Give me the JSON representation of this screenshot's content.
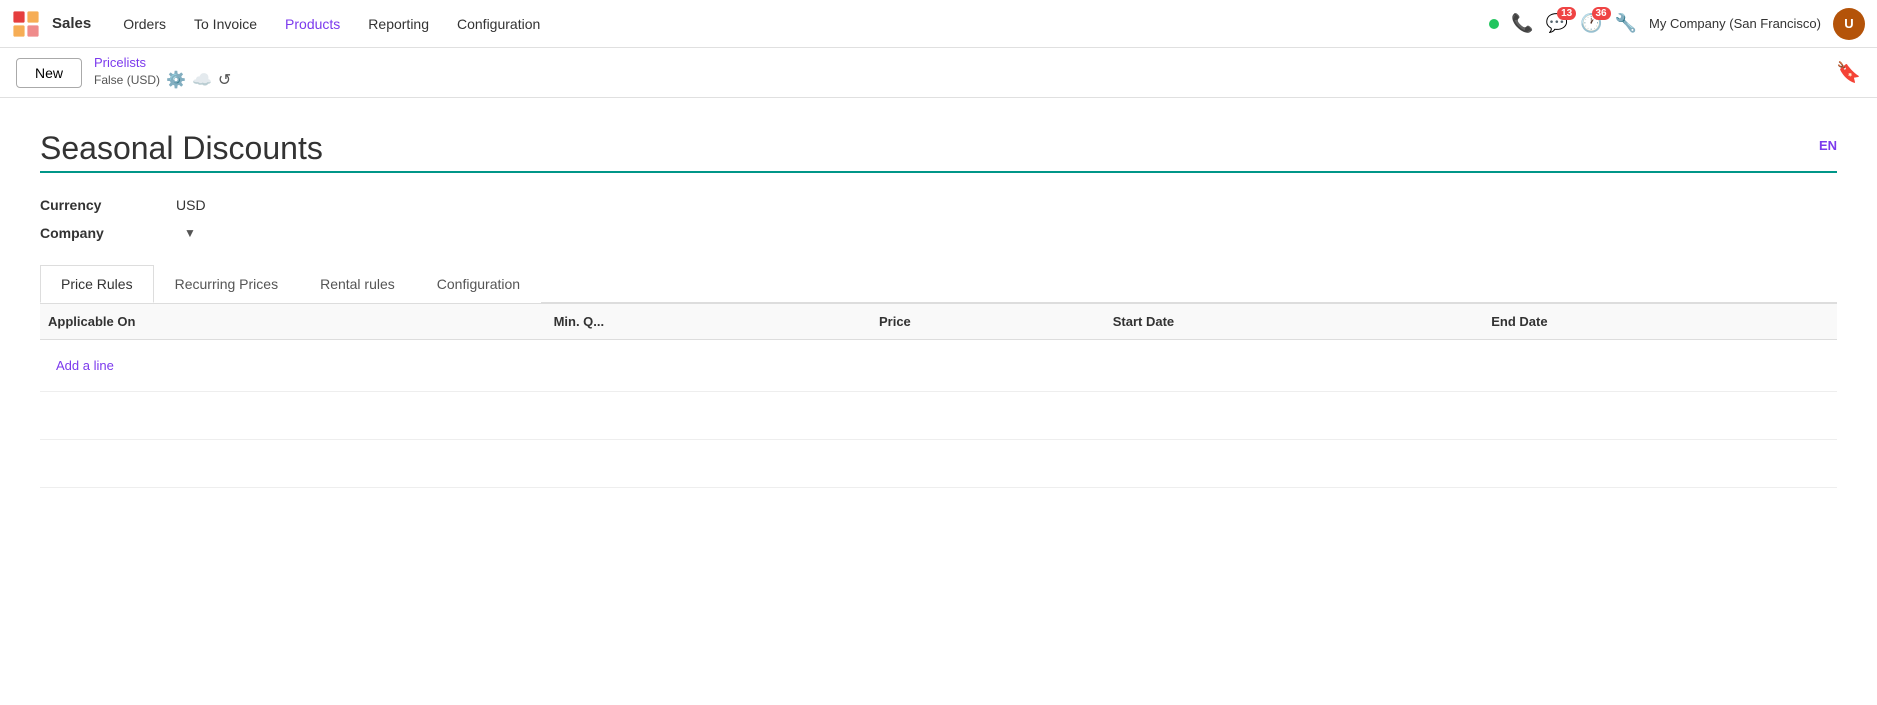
{
  "app": {
    "logo_color": "#e53e3e",
    "brand": "Sales"
  },
  "navbar": {
    "menu_items": [
      {
        "label": "Orders",
        "active": false
      },
      {
        "label": "To Invoice",
        "active": false
      },
      {
        "label": "Products",
        "active": true
      },
      {
        "label": "Reporting",
        "active": false
      },
      {
        "label": "Configuration",
        "active": false
      }
    ],
    "notifications_count": "13",
    "clock_count": "36",
    "company": "My Company (San Francisco)"
  },
  "breadcrumb": {
    "new_label": "New",
    "pricelists_label": "Pricelists",
    "sub_info": "False (USD)"
  },
  "form": {
    "title": "Seasonal Discounts",
    "lang_badge": "EN",
    "currency_label": "Currency",
    "currency_value": "USD",
    "company_label": "Company",
    "company_value": ""
  },
  "tabs": [
    {
      "label": "Price Rules",
      "active": true
    },
    {
      "label": "Recurring Prices",
      "active": false
    },
    {
      "label": "Rental rules",
      "active": false
    },
    {
      "label": "Configuration",
      "active": false
    }
  ],
  "table": {
    "columns": [
      {
        "key": "applicable_on",
        "label": "Applicable On"
      },
      {
        "key": "min_qty",
        "label": "Min. Q..."
      },
      {
        "key": "price",
        "label": "Price"
      },
      {
        "key": "start_date",
        "label": "Start Date"
      },
      {
        "key": "end_date",
        "label": "End Date"
      }
    ],
    "rows": [],
    "add_line_label": "Add a line"
  }
}
